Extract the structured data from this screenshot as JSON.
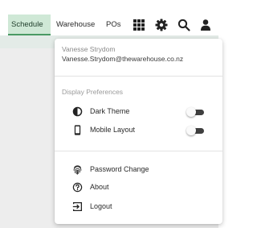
{
  "nav": {
    "tabs": [
      {
        "label": "Schedule",
        "active": true
      },
      {
        "label": "Warehouse",
        "active": false
      },
      {
        "label": "POs",
        "active": false
      }
    ],
    "icons": [
      "grid-icon",
      "gear-icon",
      "search-icon",
      "user-icon"
    ]
  },
  "menu": {
    "user": {
      "name": "Vanesse Strydom",
      "email": "Vanesse.Strydom@thewarehouse.co.nz"
    },
    "display_preferences": {
      "title": "Display Preferences",
      "items": [
        {
          "label": "Dark Theme",
          "icon": "contrast-icon",
          "enabled": false
        },
        {
          "label": "Mobile Layout",
          "icon": "phone-icon",
          "enabled": false
        }
      ]
    },
    "actions": [
      {
        "label": "Password Change",
        "icon": "fingerprint-icon"
      },
      {
        "label": "About",
        "icon": "help-icon"
      },
      {
        "label": "Logout",
        "icon": "logout-icon"
      }
    ]
  },
  "colors": {
    "active_tab_bg": "#cfe8d6",
    "active_tab_border": "#4a9a64",
    "toggle_track": "#3f3f3f"
  }
}
